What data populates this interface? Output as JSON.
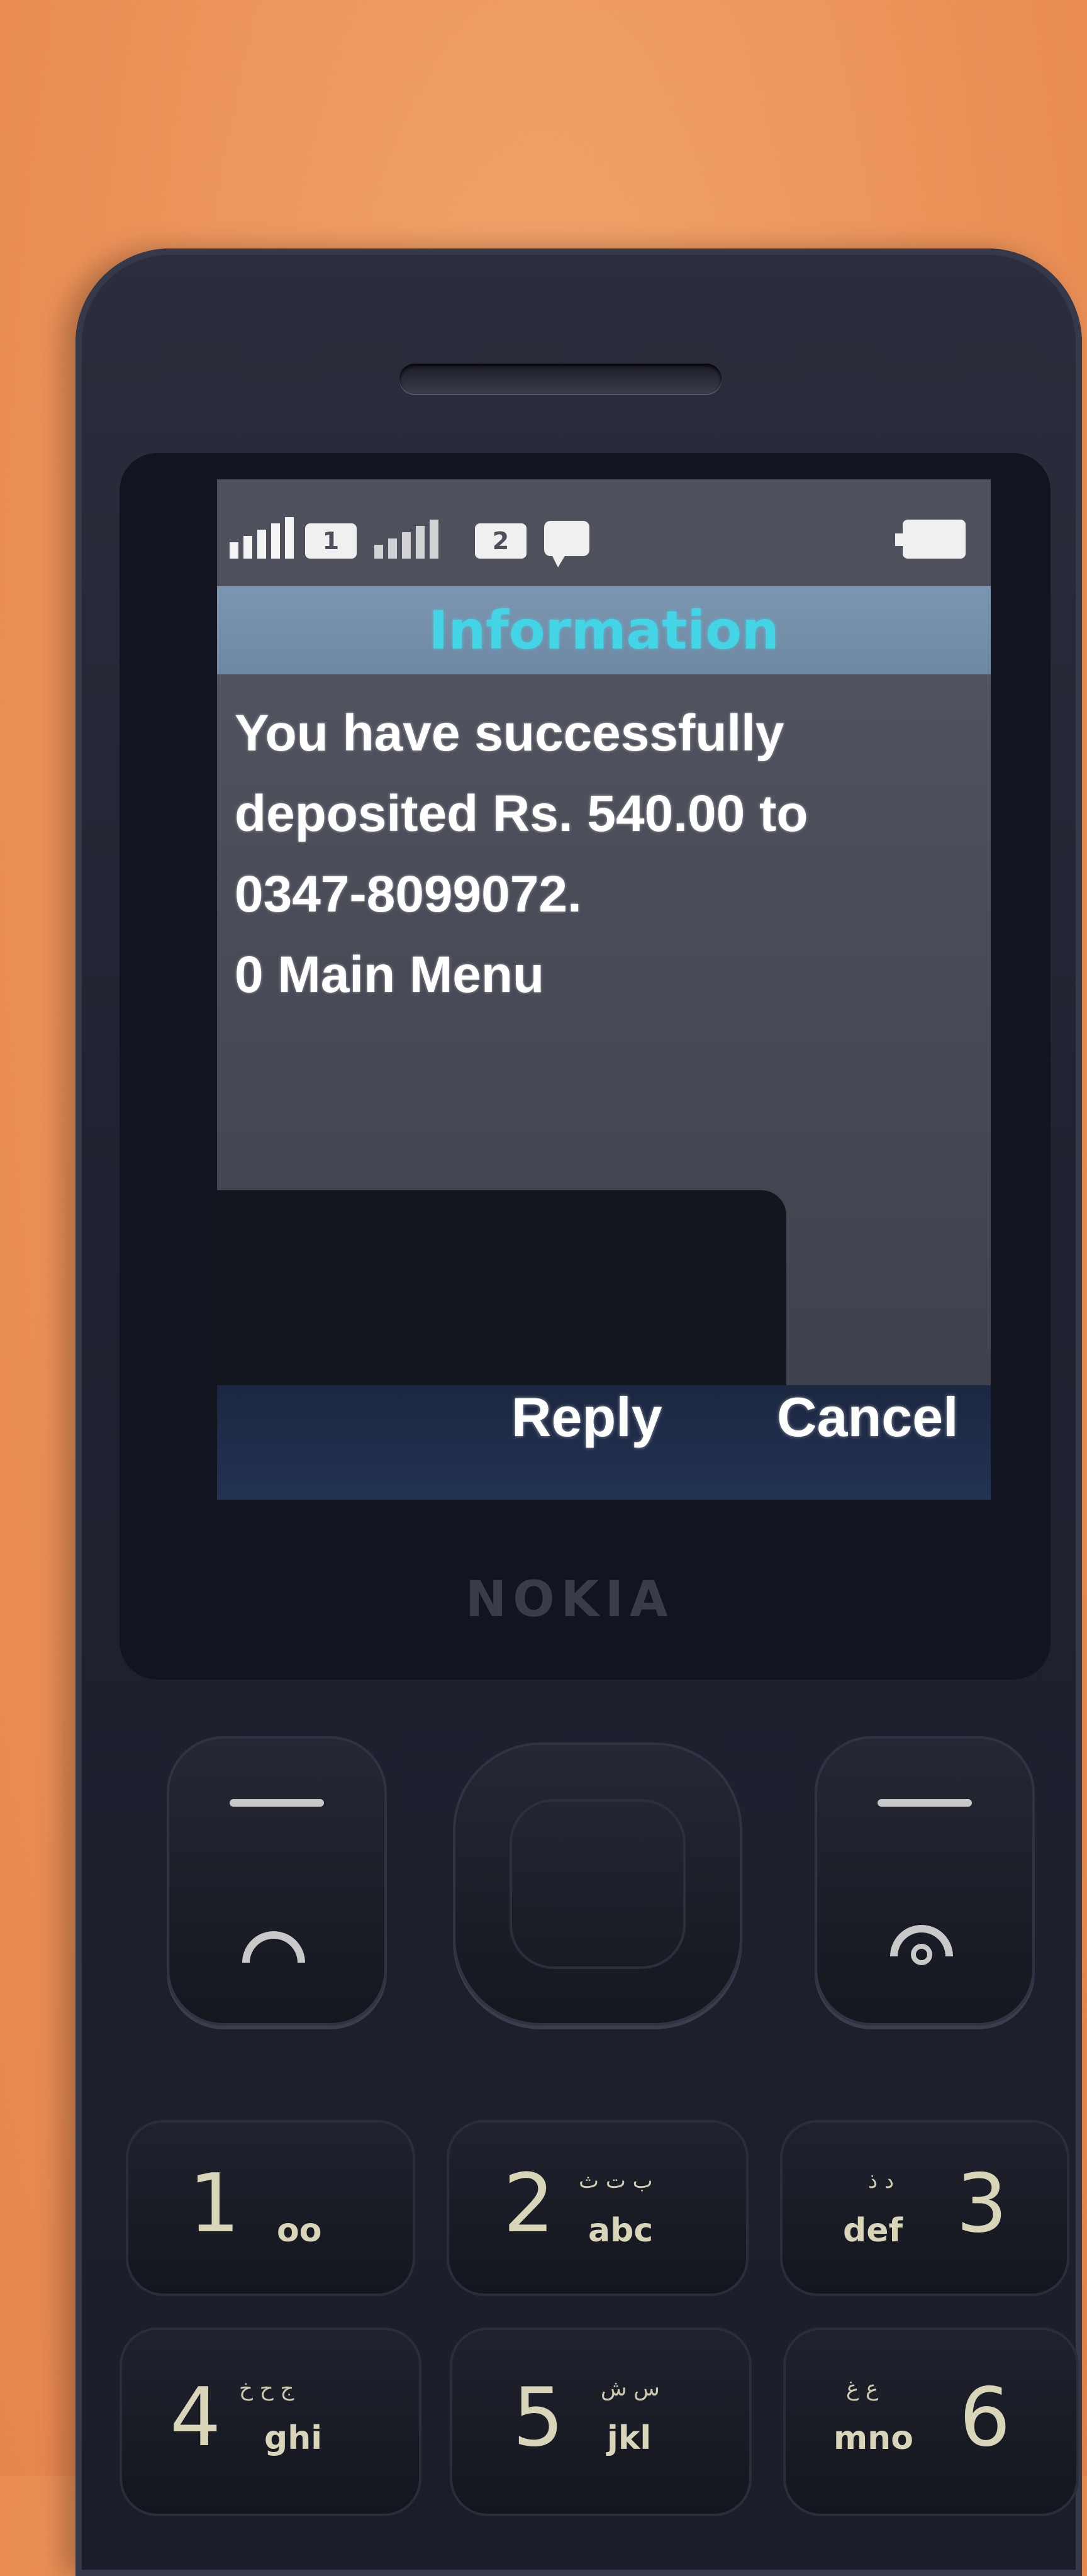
{
  "status_bar": {
    "sim1_label": "1",
    "sim2_label": "2",
    "icons": [
      "signal-strength-icon",
      "sim1-icon",
      "signal-strength-icon",
      "sim2-icon",
      "message-icon",
      "battery-icon"
    ]
  },
  "dialog": {
    "title": "Information",
    "lines": [
      "You have successfully",
      "deposited Rs. 540.00 to",
      "0347-8099072.",
      "0 Main Menu"
    ]
  },
  "softkeys": {
    "left": "Reply",
    "right": "Cancel"
  },
  "brand": "NOKIA",
  "keypad": [
    {
      "num": "1",
      "letters": "oo",
      "sub": ""
    },
    {
      "num": "2",
      "letters": "abc",
      "sub": "ب ت ث"
    },
    {
      "num": "3",
      "letters": "def",
      "sub": "د ذ"
    },
    {
      "num": "4",
      "letters": "ghi",
      "sub": "ج ح خ"
    },
    {
      "num": "5",
      "letters": "jkl",
      "sub": "س ش"
    },
    {
      "num": "6",
      "letters": "mno",
      "sub": "ع غ"
    }
  ],
  "colors": {
    "title_text": "#43d4e6",
    "title_bar": "#7c96b1",
    "screen_bg": "#4a4d58",
    "softkey_bar": "#1c2740",
    "background": "#ec935a",
    "phone_body": "#1f2230"
  }
}
